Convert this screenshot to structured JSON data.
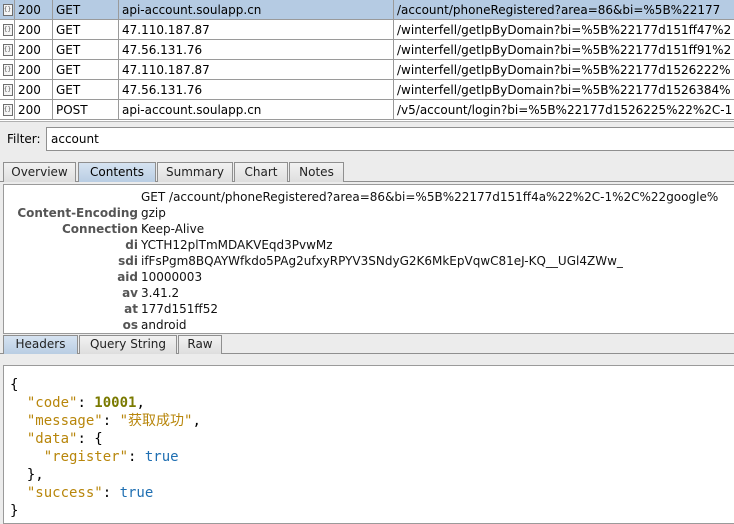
{
  "requests": [
    {
      "status": "200",
      "method": "GET",
      "host": "api-account.soulapp.cn",
      "path": "/account/phoneRegistered?area=86&bi=%5B%22177",
      "selected": true
    },
    {
      "status": "200",
      "method": "GET",
      "host": "47.110.187.87",
      "path": "/winterfell/getIpByDomain?bi=%5B%22177d151ff47%2",
      "selected": false
    },
    {
      "status": "200",
      "method": "GET",
      "host": "47.56.131.76",
      "path": "/winterfell/getIpByDomain?bi=%5B%22177d151ff91%2",
      "selected": false
    },
    {
      "status": "200",
      "method": "GET",
      "host": "47.110.187.87",
      "path": "/winterfell/getIpByDomain?bi=%5B%22177d1526222%",
      "selected": false
    },
    {
      "status": "200",
      "method": "GET",
      "host": "47.56.131.76",
      "path": "/winterfell/getIpByDomain?bi=%5B%22177d1526384%",
      "selected": false
    },
    {
      "status": "200",
      "method": "POST",
      "host": "api-account.soulapp.cn",
      "path": "/v5/account/login?bi=%5B%22177d1526225%22%2C-1",
      "selected": false
    }
  ],
  "filter": {
    "label": "Filter:",
    "value": "account"
  },
  "top_tabs": [
    {
      "label": "Overview",
      "active": false
    },
    {
      "label": "Contents",
      "active": true
    },
    {
      "label": "Summary",
      "active": false
    },
    {
      "label": "Chart",
      "active": false
    },
    {
      "label": "Notes",
      "active": false
    }
  ],
  "headers": [
    {
      "name": "",
      "value": "GET /account/phoneRegistered?area=86&bi=%5B%22177d151ff4a%22%2C-1%2C%22google%"
    },
    {
      "name": "Content-Encoding",
      "value": "gzip"
    },
    {
      "name": "Connection",
      "value": "Keep-Alive"
    },
    {
      "name": "di",
      "value": "YCTH12plTmMDAKVEqd3PvwMz"
    },
    {
      "name": "sdi",
      "value": "ifFsPgm8BQAYWfkdo5PAg2ufxyRPYV3SNdyG2K6MkEpVqwC81eJ-KQ__UGl4ZWw_"
    },
    {
      "name": "aid",
      "value": "10000003"
    },
    {
      "name": "av",
      "value": "3.41.2"
    },
    {
      "name": "at",
      "value": "177d151ff52"
    },
    {
      "name": "os",
      "value": "android"
    }
  ],
  "sub_tabs": [
    {
      "label": "Headers",
      "active": true
    },
    {
      "label": "Query String",
      "active": false
    },
    {
      "label": "Raw",
      "active": false
    }
  ],
  "body": {
    "open_brace": "{",
    "code_key": "\"code\"",
    "code_value": "10001",
    "message_key": "\"message\"",
    "message_value": "\"获取成功\"",
    "data_key": "\"data\"",
    "register_key": "\"register\"",
    "register_value": "true",
    "data_close": "},",
    "success_key": "\"success\"",
    "success_value": "true",
    "close_brace": "}"
  },
  "colors": {
    "selected_row": "#b5cbe3",
    "active_tab": "#c6d7ea",
    "json_key": "#b8860b",
    "json_number": "#7a7a00",
    "json_bool": "#1f6fb2"
  }
}
